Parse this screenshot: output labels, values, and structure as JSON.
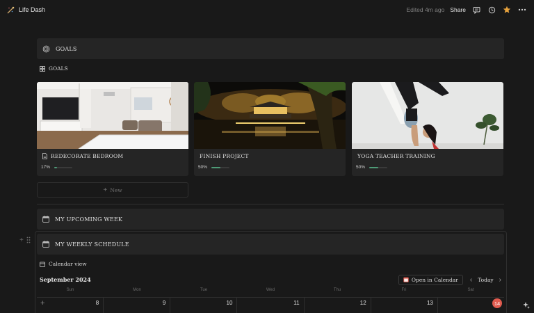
{
  "topbar": {
    "title": "Life Dash",
    "edited": "Edited 4m ago",
    "share": "Share"
  },
  "goals_header": {
    "label": "GOALS",
    "icon": "target-icon"
  },
  "goals_view": {
    "label": "GOALS",
    "icon": "gallery-icon"
  },
  "cards": [
    {
      "title": "REDECORATE BEDROOM",
      "progress_text": "17%",
      "progress": 0.17,
      "icon": "page-icon"
    },
    {
      "title": "FINISH PROJECT",
      "progress_text": "50%",
      "progress": 0.5
    },
    {
      "title": "YOGA TEACHER TRAINING",
      "progress_text": "50%",
      "progress": 0.5
    }
  ],
  "new_button": {
    "label": "New"
  },
  "upcoming": {
    "label": "MY UPCOMING WEEK",
    "icon": "calendar-icon"
  },
  "weekly": {
    "label": "MY WEEKLY SCHEDULE",
    "icon": "calendar-icon"
  },
  "calendar": {
    "view_label": "Calendar view",
    "month": "September 2024",
    "open_label": "Open in Calendar",
    "today_label": "Today",
    "days": [
      "Sun",
      "Mon",
      "Tue",
      "Wed",
      "Thu",
      "Fri",
      "Sat"
    ],
    "dates": [
      "8",
      "9",
      "10",
      "11",
      "12",
      "13",
      "14"
    ],
    "accent": "#e05b4f"
  },
  "colors": {
    "background": "#191919",
    "block": "#252525",
    "progress": "#4e9b77",
    "star": "#e8a33d"
  }
}
